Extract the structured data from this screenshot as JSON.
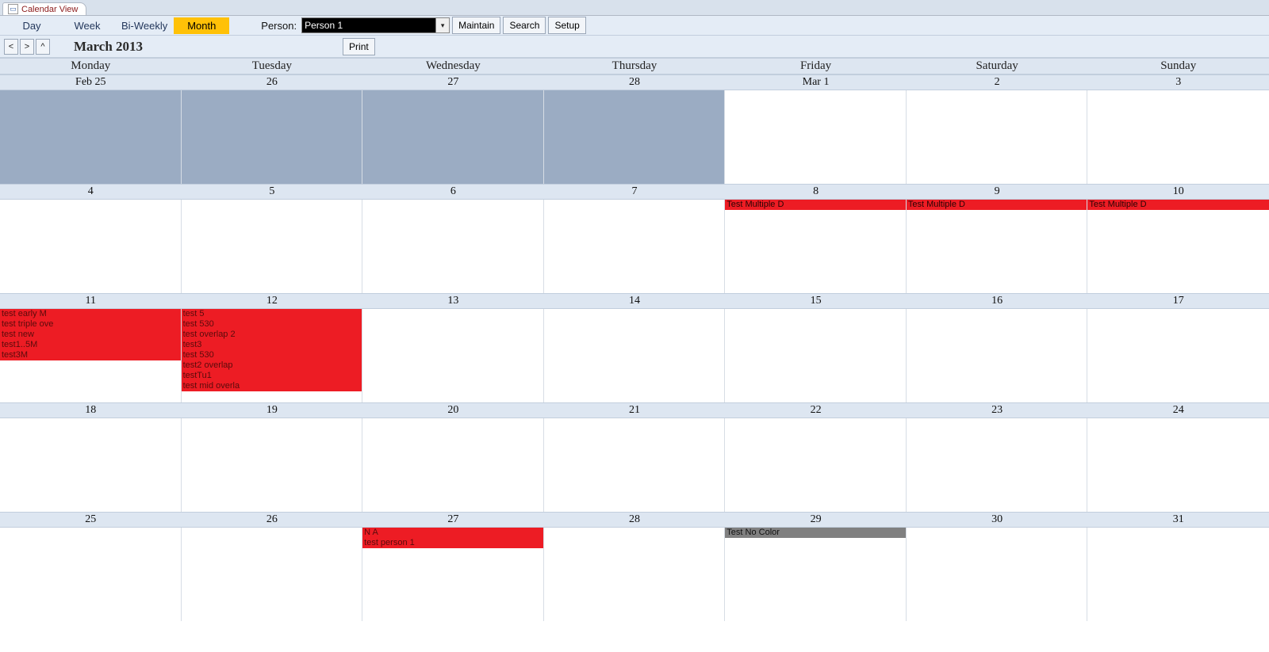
{
  "tab": {
    "title": "Calendar View"
  },
  "toolbar": {
    "views": {
      "day": "Day",
      "week": "Week",
      "biweekly": "Bi-Weekly",
      "month": "Month"
    },
    "person_label": "Person:",
    "person_value": "Person 1",
    "maintain": "Maintain",
    "search": "Search",
    "setup": "Setup"
  },
  "nav": {
    "prev": "<",
    "next": ">",
    "up": "^",
    "title": "March 2013",
    "print": "Print"
  },
  "dow": [
    "Monday",
    "Tuesday",
    "Wednesday",
    "Thursday",
    "Friday",
    "Saturday",
    "Sunday"
  ],
  "dates": {
    "w0": [
      "Feb 25",
      "26",
      "27",
      "28",
      "Mar 1",
      "2",
      "3"
    ],
    "w1": [
      "4",
      "5",
      "6",
      "7",
      "8",
      "9",
      "10"
    ],
    "w2": [
      "11",
      "12",
      "13",
      "14",
      "15",
      "16",
      "17"
    ],
    "w3": [
      "18",
      "19",
      "20",
      "21",
      "22",
      "23",
      "24"
    ],
    "w4": [
      "25",
      "26",
      "27",
      "28",
      "29",
      "30",
      "31"
    ]
  },
  "events": {
    "w1d4e0": "Test Multiple D",
    "w1d5e0": "Test Multiple D",
    "w1d6e0": "Test Multiple D",
    "w2d0e0": "test early M",
    "w2d0e1": "test triple ove",
    "w2d0e2": "test new",
    "w2d0e3": "test1..5M",
    "w2d0e4": "test3M",
    "w2d1e0": "test 5",
    "w2d1e1": "test 530",
    "w2d1e2": "test overlap 2",
    "w2d1e3": "test3",
    "w2d1e4": "test 530",
    "w2d1e5": "test2 overlap",
    "w2d1e6": "testTu1",
    "w2d1e7": "test mid overla",
    "w4d2e0": "N A",
    "w4d2e1": "test person 1",
    "w4d4e0": "Test No Color"
  }
}
